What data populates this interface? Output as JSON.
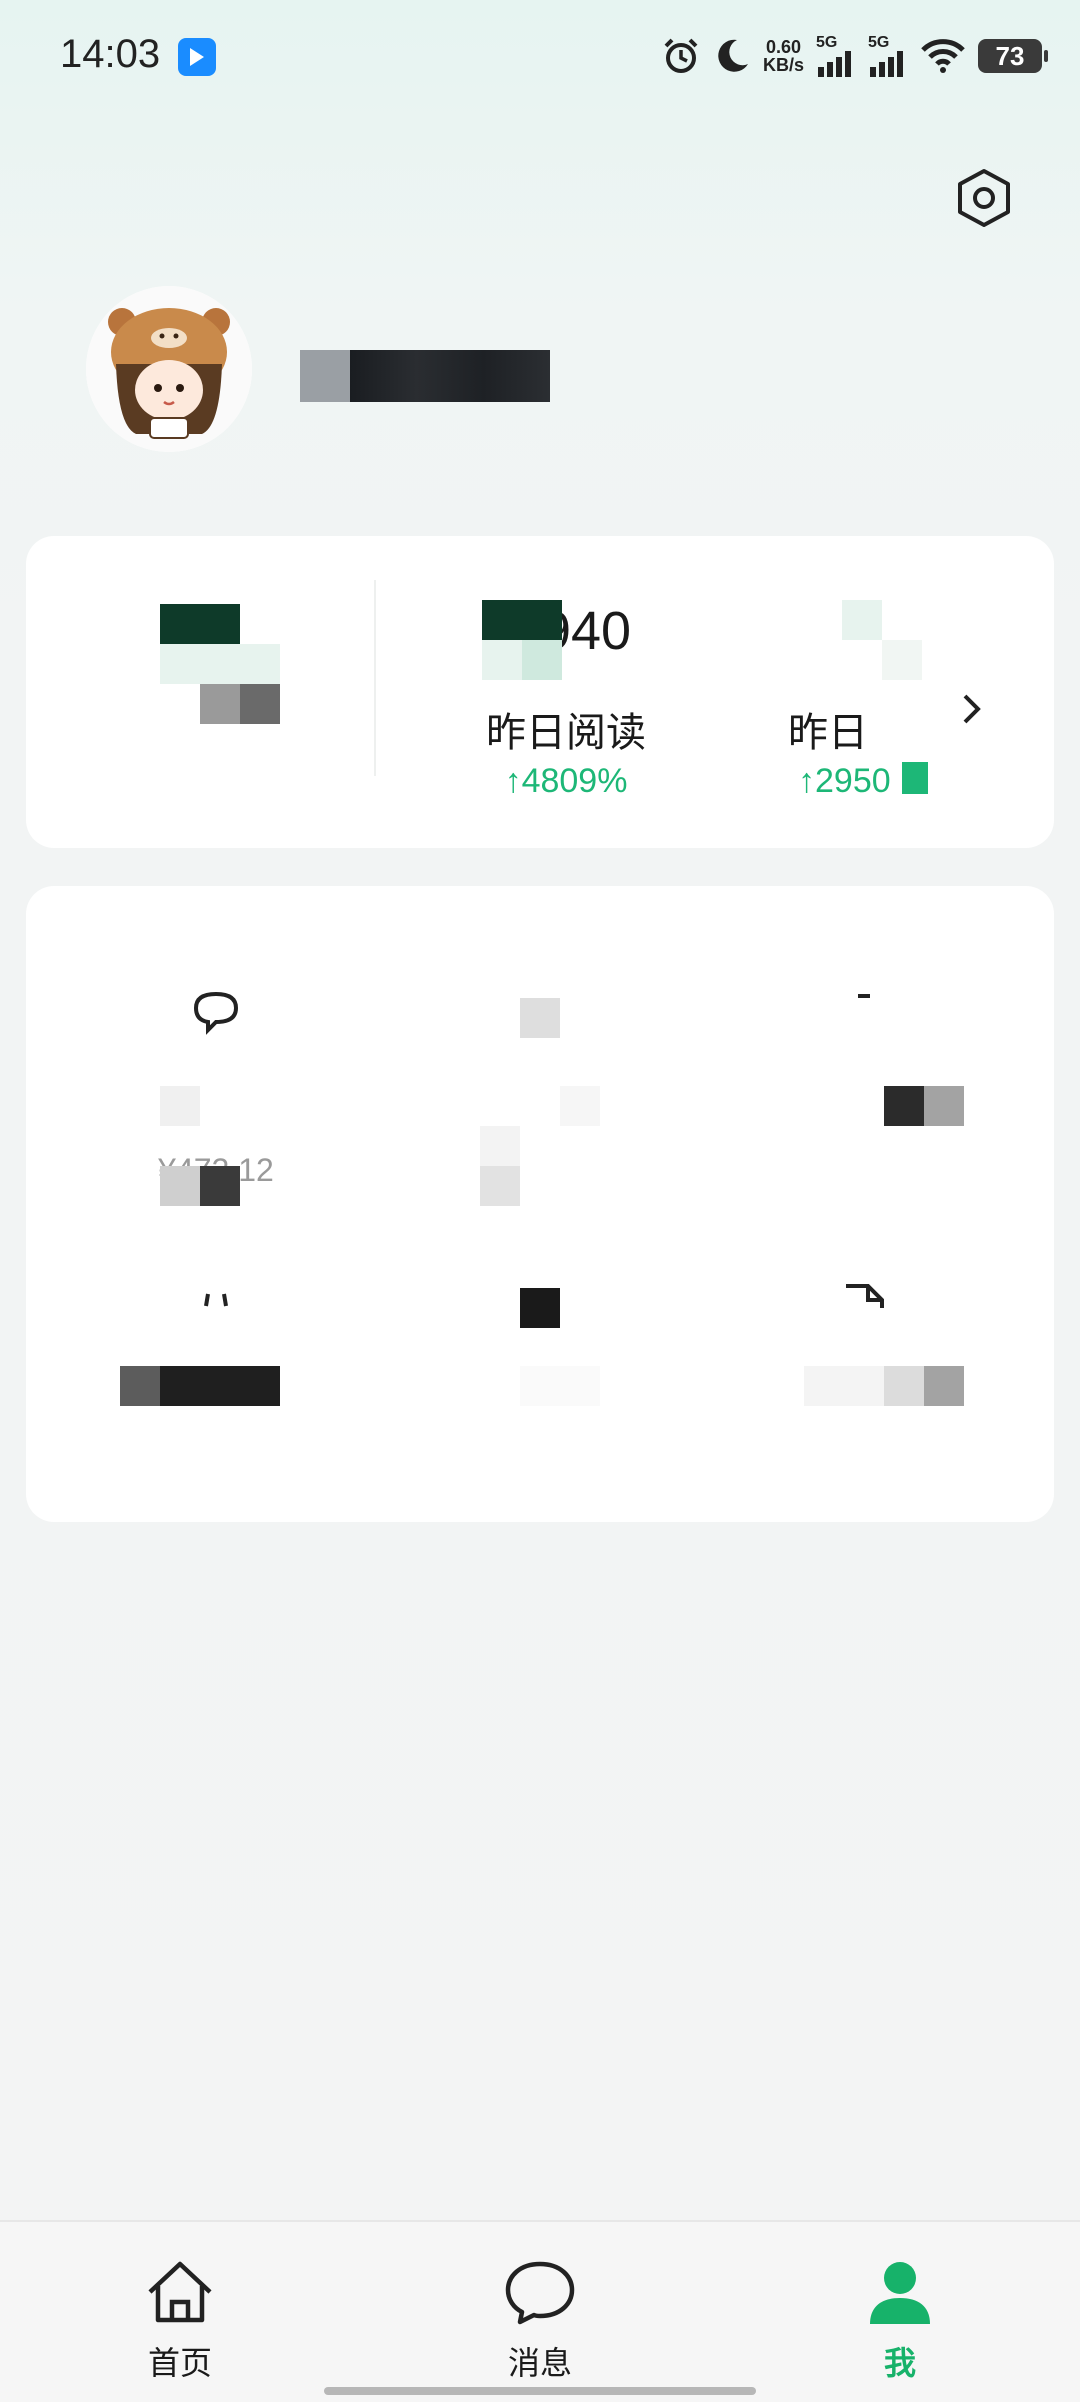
{
  "status_bar": {
    "time": "14:03",
    "net_speed_value": "0.60",
    "net_speed_unit": "KB/s",
    "sim1": "5G",
    "sim2": "5G",
    "battery": "73"
  },
  "profile": {
    "name": ""
  },
  "stats": [
    {
      "value": "",
      "label": "",
      "change": ""
    },
    {
      "value": "940",
      "label": "昨日阅读",
      "change": "↑4809%"
    },
    {
      "value": "",
      "label": "昨日",
      "change": "↑2950"
    }
  ],
  "tools": [
    {
      "name": "",
      "sub": "¥472.12",
      "icon": "comment-icon"
    },
    {
      "name": "",
      "sub": "",
      "icon": "grid-icon"
    },
    {
      "name": "",
      "sub": "",
      "icon": "dash-icon"
    },
    {
      "name": "",
      "sub": "",
      "icon": "bracket-icon"
    },
    {
      "name": "",
      "sub": "",
      "icon": "square-icon"
    },
    {
      "name": "",
      "sub": "",
      "icon": "document-icon"
    }
  ],
  "nav": {
    "home": "首页",
    "messages": "消息",
    "me": "我"
  },
  "colors": {
    "accent": "#17b26a",
    "change": "#1db777"
  }
}
